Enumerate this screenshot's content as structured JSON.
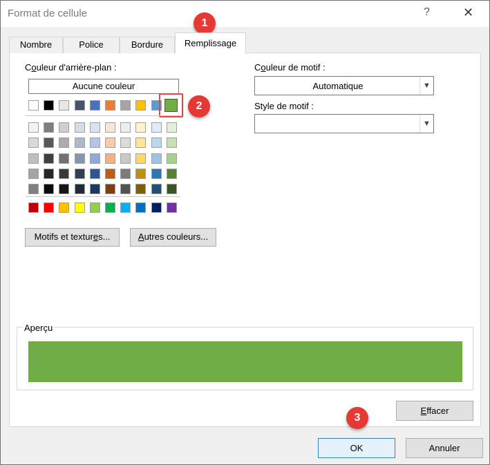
{
  "window": {
    "title": "Format de cellule",
    "help_glyph": "?",
    "close_glyph": "✕"
  },
  "tabs": [
    {
      "label": "Nombre"
    },
    {
      "label": "Police"
    },
    {
      "label": "Bordure"
    },
    {
      "label": "Remplissage",
      "active": true
    }
  ],
  "background": {
    "label": "Couleur d'arrière-plan :",
    "no_color_button": "Aucune couleur",
    "selected_color": "#70ad47",
    "theme_row": [
      "#ffffff",
      "#000000",
      "#e7e6e6",
      "#44546a",
      "#4472c4",
      "#ed7d31",
      "#a5a5a5",
      "#ffc000",
      "#5b9bd5",
      "#70ad47"
    ],
    "tint_rows": [
      [
        "#f2f2f2",
        "#7f7f7f",
        "#d0cece",
        "#d6dce4",
        "#d9e2f3",
        "#fbe5d5",
        "#ededed",
        "#fff2cc",
        "#deebf6",
        "#e2efd9"
      ],
      [
        "#d8d8d8",
        "#595959",
        "#aeaaaa",
        "#adb9ca",
        "#b4c6e7",
        "#f7cbac",
        "#dbdbdb",
        "#fee599",
        "#bdd7ee",
        "#c5e0b3"
      ],
      [
        "#bfbfbf",
        "#3f3f3f",
        "#757070",
        "#8496b0",
        "#8eaadb",
        "#f4b183",
        "#c9c9c9",
        "#ffd965",
        "#9dc3e6",
        "#a8d08d"
      ],
      [
        "#a5a5a5",
        "#262626",
        "#3a3838",
        "#323f4f",
        "#2f5496",
        "#c55a11",
        "#7b7b7b",
        "#bf9000",
        "#2e75b5",
        "#538135"
      ],
      [
        "#7f7f7f",
        "#0c0c0c",
        "#171616",
        "#222a35",
        "#1e3864",
        "#843c0b",
        "#525252",
        "#7f6000",
        "#1f4e79",
        "#375623"
      ]
    ],
    "standard_row": [
      "#c00000",
      "#ff0000",
      "#ffc000",
      "#ffff00",
      "#92d050",
      "#00b050",
      "#00b0f0",
      "#0070c0",
      "#002060",
      "#7030a0"
    ],
    "patterns_button": "Motifs et textures...",
    "more_colors_button": "Autres couleurs..."
  },
  "pattern": {
    "color_label": "Couleur de motif :",
    "color_value": "Automatique",
    "style_label": "Style de motif :",
    "style_value": ""
  },
  "preview": {
    "label": "Aperçu",
    "color": "#70ad47"
  },
  "buttons": {
    "clear": "Effacer",
    "ok": "OK",
    "cancel": "Annuler"
  },
  "badges": [
    "1",
    "2",
    "3"
  ],
  "badge_color": "#e53935"
}
